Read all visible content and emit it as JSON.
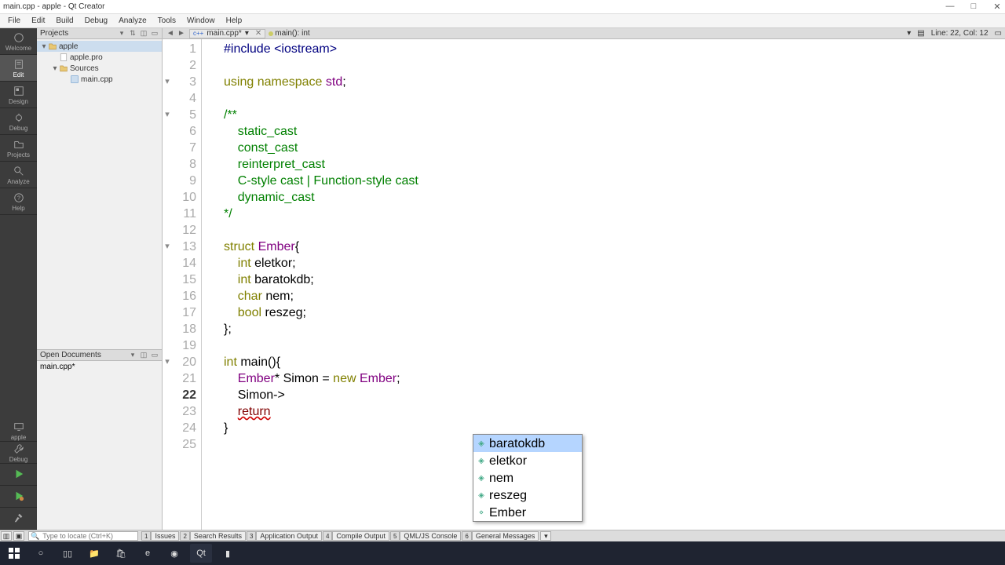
{
  "window": {
    "title": "main.cpp - apple - Qt Creator",
    "min": "—",
    "max": "□",
    "close": "✕"
  },
  "menu": [
    "File",
    "Edit",
    "Build",
    "Debug",
    "Analyze",
    "Tools",
    "Window",
    "Help"
  ],
  "leftbar": [
    {
      "id": "welcome",
      "label": "Welcome"
    },
    {
      "id": "edit",
      "label": "Edit"
    },
    {
      "id": "design",
      "label": "Design"
    },
    {
      "id": "debug",
      "label": "Debug"
    },
    {
      "id": "projects",
      "label": "Projects"
    },
    {
      "id": "analyze",
      "label": "Analyze"
    },
    {
      "id": "help",
      "label": "Help"
    }
  ],
  "leftbar_bot": {
    "project": "apple",
    "debug": "Debug"
  },
  "side": {
    "projects_label": "Projects",
    "tree": [
      {
        "depth": 0,
        "tw": "▾",
        "icon": "folder",
        "label": "apple",
        "sel": true
      },
      {
        "depth": 1,
        "tw": "",
        "icon": "file",
        "label": "apple.pro"
      },
      {
        "depth": 1,
        "tw": "▾",
        "icon": "folder",
        "label": "Sources"
      },
      {
        "depth": 2,
        "tw": "",
        "icon": "cpp",
        "label": "main.cpp"
      }
    ],
    "opendocs_label": "Open Documents",
    "opendoc": "main.cpp*"
  },
  "etool": {
    "file": "main.cpp*",
    "fn": "main(): int",
    "pos": "Line: 22, Col: 12"
  },
  "code": {
    "lines": [
      {
        "n": 1,
        "html": "<span class='pp'>#include</span> <span class='pp'>&lt;iostream&gt;</span>"
      },
      {
        "n": 2,
        "html": ""
      },
      {
        "n": 3,
        "fold": "▾",
        "html": "<span class='kw'>using</span> <span class='kw'>namespace</span> <span class='ty'>std</span>;"
      },
      {
        "n": 4,
        "html": ""
      },
      {
        "n": 5,
        "fold": "▾",
        "html": "<span class='cm'>/**</span>"
      },
      {
        "n": 6,
        "html": "<span class='cm'>    static_cast</span>"
      },
      {
        "n": 7,
        "html": "<span class='cm'>    const_cast</span>"
      },
      {
        "n": 8,
        "html": "<span class='cm'>    reinterpret_cast</span>"
      },
      {
        "n": 9,
        "html": "<span class='cm'>    C-style cast | Function-style cast</span>"
      },
      {
        "n": 10,
        "html": "<span class='cm'>    dynamic_cast</span>"
      },
      {
        "n": 11,
        "html": "<span class='cm'>*/</span>"
      },
      {
        "n": 12,
        "html": ""
      },
      {
        "n": 13,
        "fold": "▾",
        "html": "<span class='kw'>struct</span> <span class='ty'>Ember</span>{"
      },
      {
        "n": 14,
        "html": "    <span class='kw'>int</span> eletkor;"
      },
      {
        "n": 15,
        "html": "    <span class='kw'>int</span> baratokdb;"
      },
      {
        "n": 16,
        "html": "    <span class='kw'>char</span> nem;"
      },
      {
        "n": 17,
        "html": "    <span class='kw'>bool</span> reszeg;"
      },
      {
        "n": 18,
        "html": "};"
      },
      {
        "n": 19,
        "html": ""
      },
      {
        "n": 20,
        "fold": "▾",
        "html": "<span class='kw'>int</span> main(){"
      },
      {
        "n": 21,
        "html": "    <span class='ty'>Ember</span>* Simon = <span class='kw'>new</span> <span class='ty'>Ember</span>;"
      },
      {
        "n": 22,
        "cur": true,
        "html": "    Simon-&gt;"
      },
      {
        "n": 23,
        "html": "    <span class='err'>return</span>"
      },
      {
        "n": 24,
        "html": "}"
      },
      {
        "n": 25,
        "html": ""
      }
    ]
  },
  "autocomplete": [
    {
      "icon": "◈",
      "label": "baratokdb",
      "sel": true
    },
    {
      "icon": "◈",
      "label": "eletkor"
    },
    {
      "icon": "◈",
      "label": "nem"
    },
    {
      "icon": "◈",
      "label": "reszeg"
    },
    {
      "icon": "⋄",
      "label": "Ember"
    }
  ],
  "bottom": {
    "locator_ph": "Type to locate (Ctrl+K)",
    "tabs": [
      {
        "n": "1",
        "label": "Issues"
      },
      {
        "n": "2",
        "label": "Search Results"
      },
      {
        "n": "3",
        "label": "Application Output"
      },
      {
        "n": "4",
        "label": "Compile Output"
      },
      {
        "n": "5",
        "label": "QML/JS Console"
      },
      {
        "n": "6",
        "label": "General Messages"
      }
    ]
  }
}
